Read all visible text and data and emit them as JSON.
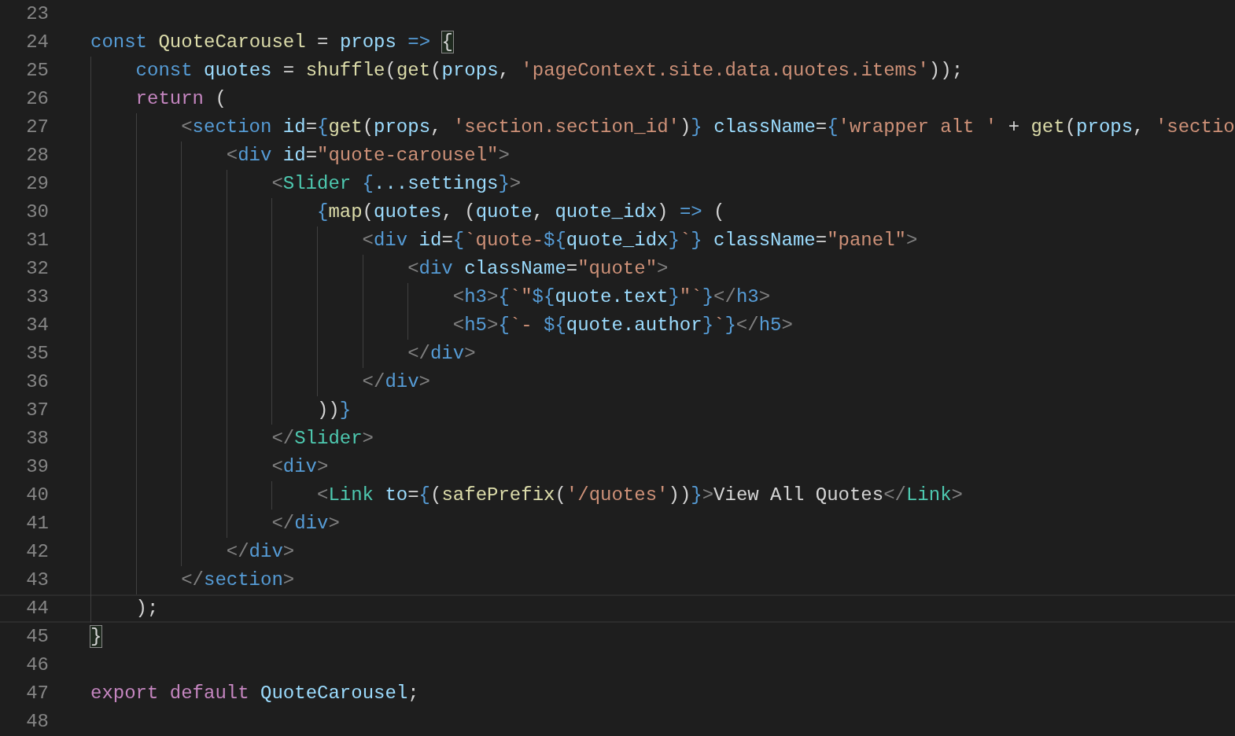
{
  "editor": {
    "lines": [
      {
        "number": "23",
        "current": false
      },
      {
        "number": "24",
        "current": false,
        "tokens": [
          {
            "text": "const ",
            "kind": "kw"
          },
          {
            "text": "QuoteCarousel",
            "kind": "fn"
          },
          {
            "text": " = ",
            "kind": "plain"
          },
          {
            "text": "props ",
            "kind": "var"
          },
          {
            "text": "=> ",
            "kind": "kw"
          },
          {
            "text": "{",
            "kind": "matched"
          }
        ]
      },
      {
        "number": "25",
        "current": false,
        "tokens": [
          {
            "text": "    const ",
            "kind": "kw"
          },
          {
            "text": "quotes",
            "kind": "var"
          },
          {
            "text": " = ",
            "kind": "plain"
          },
          {
            "text": "shuffle",
            "kind": "fn"
          },
          {
            "text": "(",
            "kind": "plain"
          },
          {
            "text": "get",
            "kind": "fn"
          },
          {
            "text": "(",
            "kind": "plain"
          },
          {
            "text": "props",
            "kind": "var"
          },
          {
            "text": ", ",
            "kind": "plain"
          },
          {
            "text": "'pageContext.site.data.quotes.items'",
            "kind": "str"
          },
          {
            "text": "));",
            "kind": "plain"
          }
        ]
      },
      {
        "number": "26",
        "current": false,
        "tokens": [
          {
            "text": "    return",
            "kind": "ctrl"
          },
          {
            "text": " (",
            "kind": "plain"
          }
        ]
      },
      {
        "number": "27",
        "current": false,
        "tokens": [
          {
            "text": "        <",
            "kind": "punct"
          },
          {
            "text": "section ",
            "kind": "tag"
          },
          {
            "text": "id",
            "kind": "attr"
          },
          {
            "text": "=",
            "kind": "plain"
          },
          {
            "text": "{",
            "kind": "brace"
          },
          {
            "text": "get",
            "kind": "fn"
          },
          {
            "text": "(",
            "kind": "plain"
          },
          {
            "text": "props",
            "kind": "var"
          },
          {
            "text": ", ",
            "kind": "plain"
          },
          {
            "text": "'section.section_id'",
            "kind": "str"
          },
          {
            "text": ")",
            "kind": "plain"
          },
          {
            "text": "} ",
            "kind": "brace"
          },
          {
            "text": "className",
            "kind": "attr"
          },
          {
            "text": "=",
            "kind": "plain"
          },
          {
            "text": "{",
            "kind": "brace"
          },
          {
            "text": "'wrapper alt '",
            "kind": "str"
          },
          {
            "text": " + ",
            "kind": "plain"
          },
          {
            "text": "get",
            "kind": "fn"
          },
          {
            "text": "(",
            "kind": "plain"
          },
          {
            "text": "props",
            "kind": "var"
          },
          {
            "text": ", ",
            "kind": "plain"
          },
          {
            "text": "'sectio",
            "kind": "str"
          }
        ]
      },
      {
        "number": "28",
        "current": false,
        "tokens": [
          {
            "text": "            <",
            "kind": "punct"
          },
          {
            "text": "div",
            "kind": "tag"
          },
          {
            "text": " id",
            "kind": "attr"
          },
          {
            "text": "=",
            "kind": "plain"
          },
          {
            "text": "\"quote-carousel\"",
            "kind": "str"
          },
          {
            "text": ">",
            "kind": "punct"
          }
        ]
      },
      {
        "number": "29",
        "current": false,
        "tokens": [
          {
            "text": "                <",
            "kind": "punct"
          },
          {
            "text": "Slider ",
            "kind": "comp"
          },
          {
            "text": "{",
            "kind": "brace"
          },
          {
            "text": "...settings",
            "kind": "var"
          },
          {
            "text": "}",
            "kind": "brace"
          },
          {
            "text": ">",
            "kind": "punct"
          }
        ]
      },
      {
        "number": "30",
        "current": false,
        "tokens": [
          {
            "text": "                    {",
            "kind": "brace"
          },
          {
            "text": "map",
            "kind": "fn"
          },
          {
            "text": "(",
            "kind": "plain"
          },
          {
            "text": "quotes",
            "kind": "var"
          },
          {
            "text": ", (",
            "kind": "plain"
          },
          {
            "text": "quote",
            "kind": "var"
          },
          {
            "text": ", ",
            "kind": "plain"
          },
          {
            "text": "quote_idx",
            "kind": "var"
          },
          {
            "text": ") ",
            "kind": "plain"
          },
          {
            "text": "=>",
            "kind": "kw"
          },
          {
            "text": " (",
            "kind": "plain"
          }
        ]
      },
      {
        "number": "31",
        "current": false,
        "tokens": [
          {
            "text": "                        <",
            "kind": "punct"
          },
          {
            "text": "div",
            "kind": "tag"
          },
          {
            "text": " id",
            "kind": "attr"
          },
          {
            "text": "=",
            "kind": "plain"
          },
          {
            "text": "{",
            "kind": "brace"
          },
          {
            "text": "`quote-",
            "kind": "str"
          },
          {
            "text": "${",
            "kind": "brace"
          },
          {
            "text": "quote_idx",
            "kind": "var"
          },
          {
            "text": "}",
            "kind": "brace"
          },
          {
            "text": "`",
            "kind": "str"
          },
          {
            "text": "}",
            "kind": "brace"
          },
          {
            "text": " className",
            "kind": "attr"
          },
          {
            "text": "=",
            "kind": "plain"
          },
          {
            "text": "\"panel\"",
            "kind": "str"
          },
          {
            "text": ">",
            "kind": "punct"
          }
        ]
      },
      {
        "number": "32",
        "current": false,
        "tokens": [
          {
            "text": "                            <",
            "kind": "punct"
          },
          {
            "text": "div",
            "kind": "tag"
          },
          {
            "text": " className",
            "kind": "attr"
          },
          {
            "text": "=",
            "kind": "plain"
          },
          {
            "text": "\"quote\"",
            "kind": "str"
          },
          {
            "text": ">",
            "kind": "punct"
          }
        ]
      },
      {
        "number": "33",
        "current": false,
        "tokens": [
          {
            "text": "                                <",
            "kind": "punct"
          },
          {
            "text": "h3",
            "kind": "tag"
          },
          {
            "text": ">",
            "kind": "punct"
          },
          {
            "text": "{",
            "kind": "brace"
          },
          {
            "text": "`\"",
            "kind": "str"
          },
          {
            "text": "${",
            "kind": "brace"
          },
          {
            "text": "quote.text",
            "kind": "var"
          },
          {
            "text": "}",
            "kind": "brace"
          },
          {
            "text": "\"`",
            "kind": "str"
          },
          {
            "text": "}",
            "kind": "brace"
          },
          {
            "text": "</",
            "kind": "punct"
          },
          {
            "text": "h3",
            "kind": "tag"
          },
          {
            "text": ">",
            "kind": "punct"
          }
        ]
      },
      {
        "number": "34",
        "current": false,
        "tokens": [
          {
            "text": "                                <",
            "kind": "punct"
          },
          {
            "text": "h5",
            "kind": "tag"
          },
          {
            "text": ">",
            "kind": "punct"
          },
          {
            "text": "{",
            "kind": "brace"
          },
          {
            "text": "`- ",
            "kind": "str"
          },
          {
            "text": "${",
            "kind": "brace"
          },
          {
            "text": "quote.author",
            "kind": "var"
          },
          {
            "text": "}",
            "kind": "brace"
          },
          {
            "text": "`",
            "kind": "str"
          },
          {
            "text": "}",
            "kind": "brace"
          },
          {
            "text": "</",
            "kind": "punct"
          },
          {
            "text": "h5",
            "kind": "tag"
          },
          {
            "text": ">",
            "kind": "punct"
          }
        ]
      },
      {
        "number": "35",
        "current": false,
        "tokens": [
          {
            "text": "                            </",
            "kind": "punct"
          },
          {
            "text": "div",
            "kind": "tag"
          },
          {
            "text": ">",
            "kind": "punct"
          }
        ]
      },
      {
        "number": "36",
        "current": false,
        "tokens": [
          {
            "text": "                        </",
            "kind": "punct"
          },
          {
            "text": "div",
            "kind": "tag"
          },
          {
            "text": ">",
            "kind": "punct"
          }
        ]
      },
      {
        "number": "37",
        "current": false,
        "tokens": [
          {
            "text": "                    ))",
            "kind": "plain"
          },
          {
            "text": "}",
            "kind": "brace"
          }
        ]
      },
      {
        "number": "38",
        "current": false,
        "tokens": [
          {
            "text": "                </",
            "kind": "punct"
          },
          {
            "text": "Slider",
            "kind": "comp"
          },
          {
            "text": ">",
            "kind": "punct"
          }
        ]
      },
      {
        "number": "39",
        "current": false,
        "tokens": [
          {
            "text": "                <",
            "kind": "punct"
          },
          {
            "text": "div",
            "kind": "tag"
          },
          {
            "text": ">",
            "kind": "punct"
          }
        ]
      },
      {
        "number": "40",
        "current": false,
        "tokens": [
          {
            "text": "                    <",
            "kind": "punct"
          },
          {
            "text": "Link",
            "kind": "comp"
          },
          {
            "text": " to",
            "kind": "attr"
          },
          {
            "text": "=",
            "kind": "plain"
          },
          {
            "text": "{",
            "kind": "brace"
          },
          {
            "text": "(",
            "kind": "plain"
          },
          {
            "text": "safePrefix",
            "kind": "fn"
          },
          {
            "text": "(",
            "kind": "plain"
          },
          {
            "text": "'/quotes'",
            "kind": "str"
          },
          {
            "text": "))",
            "kind": "plain"
          },
          {
            "text": "}",
            "kind": "brace"
          },
          {
            "text": ">",
            "kind": "punct"
          },
          {
            "text": "View All Quotes",
            "kind": "plain"
          },
          {
            "text": "</",
            "kind": "punct"
          },
          {
            "text": "Link",
            "kind": "comp"
          },
          {
            "text": ">",
            "kind": "punct"
          }
        ]
      },
      {
        "number": "41",
        "current": false,
        "tokens": [
          {
            "text": "                </",
            "kind": "punct"
          },
          {
            "text": "div",
            "kind": "tag"
          },
          {
            "text": ">",
            "kind": "punct"
          }
        ]
      },
      {
        "number": "42",
        "current": false,
        "tokens": [
          {
            "text": "            </",
            "kind": "punct"
          },
          {
            "text": "div",
            "kind": "tag"
          },
          {
            "text": ">",
            "kind": "punct"
          }
        ]
      },
      {
        "number": "43",
        "current": false,
        "tokens": [
          {
            "text": "        </",
            "kind": "punct"
          },
          {
            "text": "section",
            "kind": "tag"
          },
          {
            "text": ">",
            "kind": "punct"
          }
        ]
      },
      {
        "number": "44",
        "current": true,
        "tokens": [
          {
            "text": "    );",
            "kind": "plain"
          }
        ]
      },
      {
        "number": "45",
        "current": false,
        "tokens": [
          {
            "text": "}",
            "kind": "matched"
          }
        ]
      },
      {
        "number": "46",
        "current": false
      },
      {
        "number": "47",
        "current": false,
        "tokens": [
          {
            "text": "export default ",
            "kind": "ctrl"
          },
          {
            "text": "QuoteCarousel",
            "kind": "var"
          },
          {
            "text": ";",
            "kind": "plain"
          }
        ]
      },
      {
        "number": "48",
        "current": false
      }
    ]
  }
}
